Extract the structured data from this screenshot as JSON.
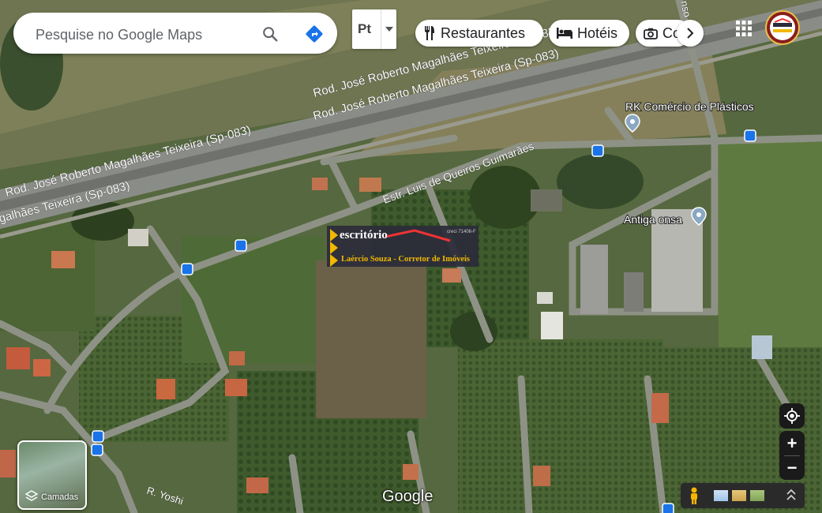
{
  "search": {
    "placeholder": "Pesquise no Google Maps"
  },
  "language": {
    "label": "Pt"
  },
  "chips": [
    {
      "label": "Restaurantes",
      "icon": "fork-knife-icon"
    },
    {
      "label": "Hotéis",
      "icon": "bed-icon"
    },
    {
      "label": "Co",
      "icon": "camera-icon"
    }
  ],
  "map": {
    "roads": {
      "highway_upper": "Rod. José Roberto Magalhães Teixeira (Sp-083)",
      "highway_upper_2": "Rod. José Roberto Magalhães Teixeira (Sp-083)",
      "highway_lower": "Rod. José Roberto Magalhães Teixeira (Sp-083)",
      "highway_lower_2": "galhães Teixeira (Sp-083)",
      "estrada": "Estr. Luis de Queiros Guimarães",
      "bottom_street": "R. Yoshi",
      "top_right_street": "nso ma"
    },
    "places": [
      {
        "name": "RK Comércio de Plásticos",
        "icon": "map-pin-icon"
      },
      {
        "name": "Antiga onsa",
        "icon": "map-pin-icon"
      }
    ]
  },
  "watermark": {
    "line1": "escritório",
    "line2": "Laércio Souza - Corretor de Imóveis",
    "creci": "creci 71406-F"
  },
  "layers": {
    "label": "Camadas"
  },
  "google_logo": "Google",
  "controls": {
    "zoom_in": "+",
    "zoom_out": "−"
  },
  "colors": {
    "accent": "#1a73e8",
    "satellite_base": "#4a5a3e"
  }
}
